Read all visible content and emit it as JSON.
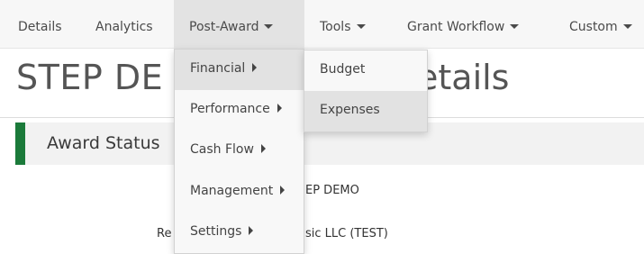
{
  "nav": {
    "details": "Details",
    "analytics": "Analytics",
    "post_award": "Post-Award",
    "tools": "Tools",
    "grant_workflow": "Grant Workflow",
    "custom": "Custom"
  },
  "page": {
    "title_visible": "STEP DE",
    "title_tail": "etails"
  },
  "award_status": {
    "label": "Award Status"
  },
  "details": {
    "row1_value": "EP DEMO",
    "row2_label": "Re",
    "row2_value": "sic LLC (TEST)"
  },
  "post_award_menu": {
    "items": [
      "Financial",
      "Performance",
      "Cash Flow",
      "Management",
      "Settings"
    ],
    "highlighted": "Financial"
  },
  "financial_submenu": {
    "items": [
      "Budget",
      "Expenses"
    ],
    "highlighted": "Expenses"
  },
  "colors": {
    "status_accent": "#1b7a3a",
    "menu_highlight": "#e2e2e2"
  }
}
